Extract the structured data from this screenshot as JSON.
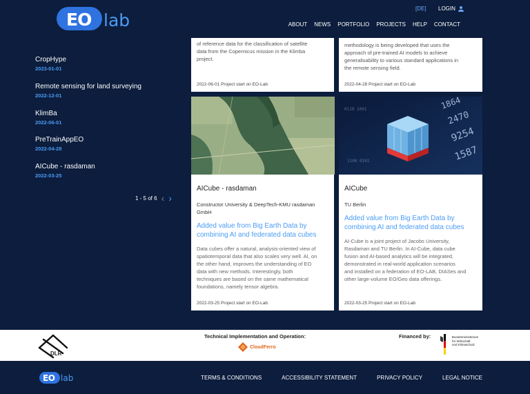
{
  "header": {
    "logo_eo": "EO",
    "logo_lab": "lab",
    "lang": "[DE]",
    "login": "LOGIN",
    "nav": [
      "ABOUT",
      "NEWS",
      "PORTFOLIO",
      "PROJECTS",
      "HELP",
      "CONTACT"
    ]
  },
  "sidebar": {
    "items": [
      {
        "title": "CropHype",
        "date": "2023-01-01"
      },
      {
        "title": "Remote sensing for land surveying",
        "date": "2022-12-01"
      },
      {
        "title": "KlimBa",
        "date": "2022-06-01"
      },
      {
        "title": "PreTrainAppEO",
        "date": "2022-04-28"
      },
      {
        "title": "AICube - rasdaman",
        "date": "2022-03-25"
      }
    ],
    "pager": "1 - 5 of 6"
  },
  "cards": {
    "top_left": {
      "snippet": [
        "of reference data for the classification of satellite",
        "data from the Copernicus mission in the Klimba",
        "project."
      ],
      "footer": "2022-06-01 Project start on EO-Lab"
    },
    "top_right": {
      "snippet": [
        "methodology is being developed that uses the",
        "approach of pre-trained AI models to achieve",
        "generalisability to various standard applications in",
        "the remote sensing field."
      ],
      "footer": "2022-04-28 Project start on EO-Lab"
    },
    "bottom_left": {
      "title": "AICube - rasdaman",
      "org": [
        "Constructor University & DeepTech-KMU rasdaman",
        "GmbH"
      ],
      "subtitle": [
        "Added value from Big Earth Data by",
        "combining AI and federated data cubes"
      ],
      "body": [
        "Data cubes offer a natural, analysis-oriented view of",
        "spatiotemporal data that also scales very well. AI, on",
        "the other hand, improves the understanding of EO",
        "data with new methods. Interestingly, both",
        "techniques are based on the same mathematical",
        "foundations, namely tensor algebra."
      ],
      "footer": "2022-03-25 Project start on EO-Lab"
    },
    "bottom_right": {
      "title": "AICube",
      "org": [
        "TU Berlin"
      ],
      "subtitle": [
        "Added value from Big Earth Data by",
        "combining AI and federated data cubes"
      ],
      "body": [
        "AI-Cube is a joint project of Jacobs University,",
        "Rasdaman and TU Berlin. In AI-Cube, data cube",
        "fusion and AI-based analytics will be integrated,",
        "demonstrated in real-world application scenarios",
        "and installed on a federation of EO-LAB, DIASes and",
        "other large-volume EO/Geo data offerings."
      ],
      "footer": "2022-03-25 Project start on EO-Lab"
    }
  },
  "partners": {
    "tech_label": "Technical Implementation and Operation:",
    "finance_label": "Financed by:",
    "dlr": "DLR",
    "cloudferro": "CloudFerro",
    "bmwk": [
      "Bundesministerium",
      "für Wirtschaft",
      "und Klimaschutz"
    ]
  },
  "footer": {
    "links": [
      "TERMS & CONDITIONS",
      "ACCESSIBILITY STATEMENT",
      "PRIVACY POLICY",
      "LEGAL NOTICE"
    ]
  },
  "colors": {
    "background": "#0c1d3d",
    "accent": "#4a9cf5",
    "logo_blue": "#2f73e0"
  }
}
